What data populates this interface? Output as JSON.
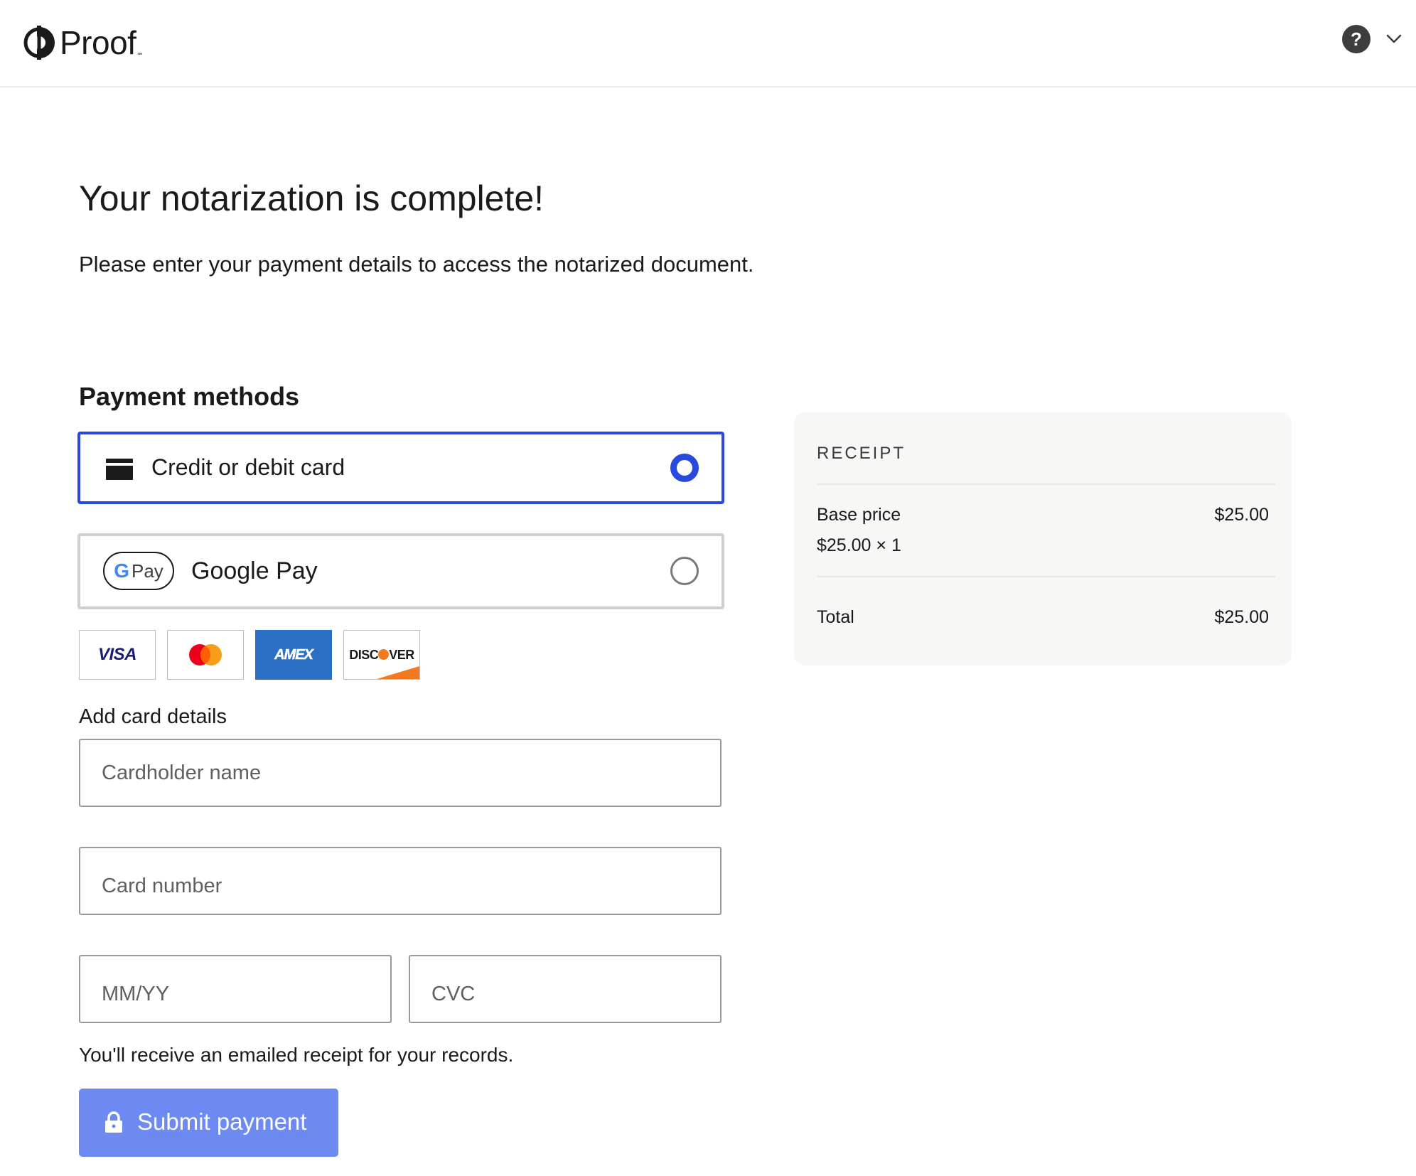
{
  "header": {
    "logo_text": "Proof",
    "logo_tm": "℠",
    "help_icon": "question-circle-icon",
    "help_glyph": "?",
    "menu_icon": "chevron-down-icon"
  },
  "main": {
    "title": "Your notarization is complete!",
    "subtitle": "Please enter your payment details to access the notarized document."
  },
  "payment_methods": {
    "title": "Payment methods",
    "options": [
      {
        "label": "Credit or debit card",
        "icon": "credit-card-icon",
        "selected": true
      },
      {
        "label": "Google Pay",
        "icon": "google-pay-badge",
        "badge_g": "G",
        "badge_text": "Pay",
        "selected": false
      }
    ],
    "accent_color": "#2948e0"
  },
  "card_brands": {
    "visa": "VISA",
    "mastercard": "mastercard-logo",
    "amex": "AMEX",
    "discover_prefix": "DISC",
    "discover_suffix": "VER"
  },
  "card_details": {
    "label": "Add card details",
    "cardholder_placeholder": "Cardholder name",
    "card_number_placeholder": "Card number",
    "expiry_placeholder": "MM/YY",
    "cvc_placeholder": "CVC",
    "cardholder_value": "",
    "card_number_value": "",
    "expiry_value": "",
    "cvc_value": ""
  },
  "footer": {
    "note": "You'll receive an emailed receipt for your records.",
    "submit_label": "Submit payment",
    "submit_icon": "lock-icon",
    "submit_color": "#6c8af2"
  },
  "receipt": {
    "title": "RECEIPT",
    "base_label": "Base price",
    "base_value": "$25.00",
    "base_detail": "$25.00 × 1",
    "total_label": "Total",
    "total_value": "$25.00"
  }
}
